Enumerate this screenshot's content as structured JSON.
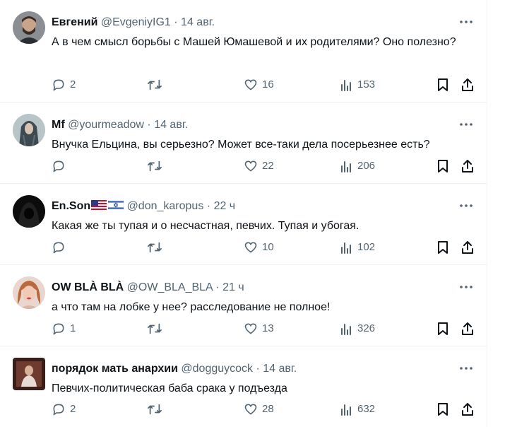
{
  "tweets": [
    {
      "name": "Евгений",
      "handle": "@EvgeniyIG1",
      "time": "14 авг.",
      "text": "А в чем смысл борьбы с Машей Юмашевой и их родителями? Оно полезно?",
      "replies": "2",
      "retweets": "",
      "likes": "16",
      "views": "153"
    },
    {
      "name": "Mf",
      "handle": "@yourmeadow",
      "time": "14 авг.",
      "text": "Внучка Ельцина, вы серьезно? Может все-таки дела посерьезнее есть?",
      "replies": "",
      "retweets": "",
      "likes": "22",
      "views": "206"
    },
    {
      "name": "En.Son",
      "handle": "@don_karopus",
      "time": "22 ч",
      "text": "Какая же ты тупая и о несчастная, певчих. Тупая и убогая.",
      "replies": "",
      "retweets": "",
      "likes": "10",
      "views": "102"
    },
    {
      "name": "OW BLÀ BLÀ",
      "handle": "@OW_BLA_BLA",
      "time": "21 ч",
      "text": "а что там на лобке у нее? расследование не полное!",
      "replies": "1",
      "retweets": "",
      "likes": "13",
      "views": "326"
    },
    {
      "name": "порядок мать анархии",
      "handle": "@dogguycock",
      "time": "14 авг.",
      "text": "Певчих-политическая баба срака у подъезда",
      "replies": "2",
      "retweets": "",
      "likes": "28",
      "views": "632"
    }
  ],
  "separator": "·",
  "colors": {
    "text": "#0f1419",
    "secondary": "#536471",
    "divider": "#eff3f4"
  },
  "icons": [
    "more-icon",
    "reply-icon",
    "retweet-icon",
    "like-icon",
    "views-icon",
    "bookmark-icon",
    "share-icon",
    "us-flag-icon",
    "israel-flag-icon"
  ]
}
